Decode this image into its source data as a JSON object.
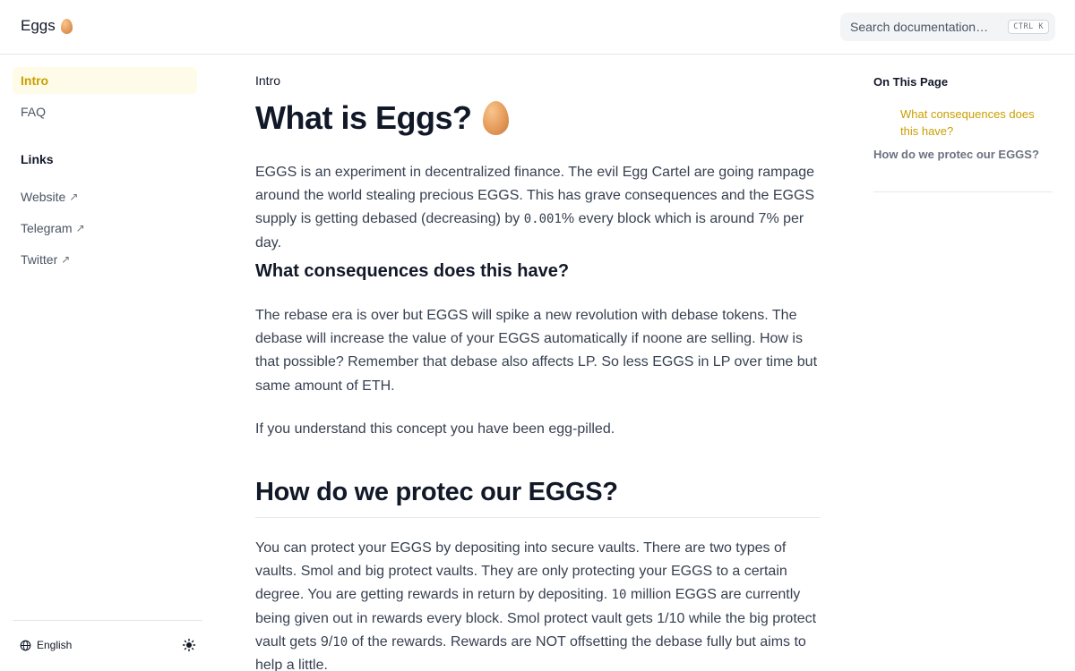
{
  "header": {
    "brand": "Eggs",
    "brand_icon": "egg-emoji",
    "search_placeholder": "Search documentation…",
    "shortcut": "CTRL K"
  },
  "sidebar": {
    "items": [
      {
        "label": "Intro",
        "active": true
      },
      {
        "label": "FAQ",
        "active": false
      }
    ],
    "links_heading": "Links",
    "links": [
      {
        "label": "Website",
        "icon": "external-arrow-icon"
      },
      {
        "label": "Telegram",
        "icon": "external-arrow-icon"
      },
      {
        "label": "Twitter",
        "icon": "external-arrow-icon"
      }
    ],
    "footer": {
      "language": "English",
      "language_icon": "globe-icon",
      "theme_icon": "sun-icon"
    }
  },
  "main": {
    "breadcrumb": "Intro",
    "title": "What is Eggs?",
    "p1_a": "EGGS is an experiment in decentralized finance. The evil Egg Cartel are going rampage around the world stealing precious EGGS. This has grave consequences and the EGGS supply is getting debased (decreasing) by ",
    "p1_mono": "0.001",
    "p1_b": "% every block which is around 7% per day.",
    "h2": "What consequences does this have?",
    "p2": "The rebase era is over but EGGS will spike a new revolution with debase tokens. The debase will increase the value of your EGGS automatically if noone are selling. How is that possible? Remember that debase also affects LP. So less EGGS in LP over time but same amount of ETH.",
    "p3": "If you understand this concept you have been egg-pilled.",
    "h1b": "How do we protec our EGGS?",
    "p4_a": "You can protect your EGGS by depositing into secure vaults. There are two types of vaults. Smol and big protect vaults. They are only protecting your EGGS to a certain degree. You are getting rewards in return by depositing. ",
    "p4_mono1": "10",
    "p4_b": " million EGGS are currently being given out in rewards every block. Smol protect vault gets 1/10 while the big protect vault gets 9/",
    "p4_mono2": "10",
    "p4_c": " of the rewards. Rewards are NOT offsetting the debase fully but aims to help a little."
  },
  "toc": {
    "title": "On This Page",
    "items": [
      {
        "label": "What consequences does this have?",
        "active": true
      },
      {
        "label": "How do we protec our EGGS?",
        "active": false
      }
    ]
  },
  "colors": {
    "accent": "#ca9f00",
    "active_bg": "#fefce8",
    "text": "#374151"
  }
}
